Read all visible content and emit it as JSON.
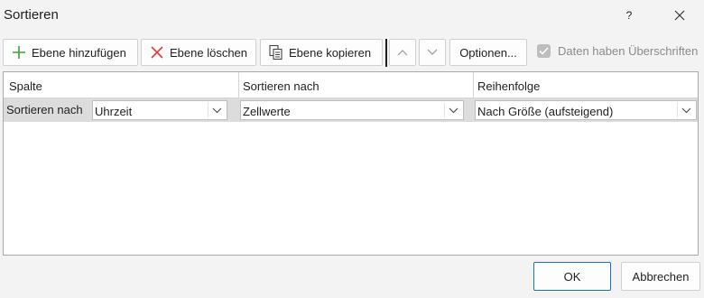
{
  "window": {
    "title": "Sortieren",
    "help_label": "?"
  },
  "toolbar": {
    "add_label": "Ebene hinzufügen",
    "delete_label": "Ebene löschen",
    "copy_label": "Ebene kopieren",
    "options_label": "Optionen...",
    "headers_checkbox_label": "Daten haben Überschriften",
    "headers_checked": true
  },
  "grid": {
    "columns": [
      "Spalte",
      "Sortieren nach",
      "Reihenfolge"
    ],
    "rows": [
      {
        "label": "Sortieren nach",
        "column": "Uhrzeit",
        "sort_on": "Zellwerte",
        "order": "Nach Größe (aufsteigend)"
      }
    ]
  },
  "footer": {
    "ok_label": "OK",
    "cancel_label": "Abbrechen"
  },
  "colors": {
    "add_icon": "#3aa13a",
    "delete_icon": "#e23b3b",
    "accent": "#1a6fc9",
    "row_bg": "#dcdcdc"
  },
  "icons": [
    "plus-icon",
    "x-icon",
    "copy-icon",
    "chevron-up-icon",
    "chevron-down-icon",
    "close-icon",
    "check-icon"
  ]
}
